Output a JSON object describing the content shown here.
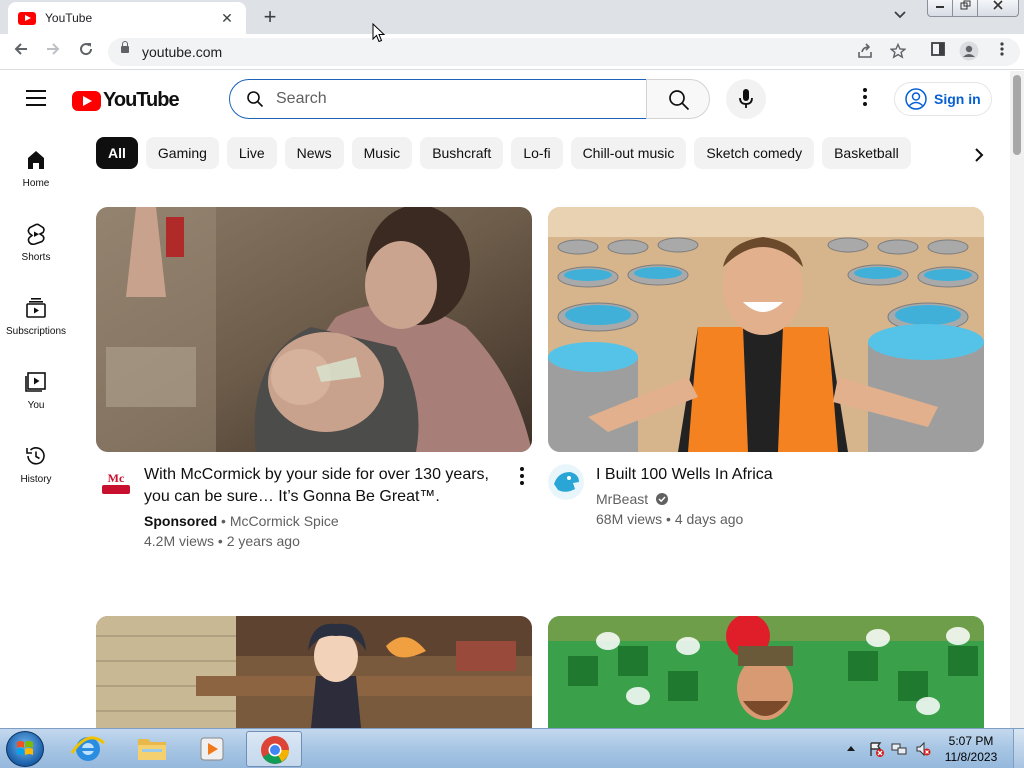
{
  "browser": {
    "tab_title": "YouTube",
    "tab_close": "✕",
    "new_tab": "+",
    "url": "youtube.com"
  },
  "youtube": {
    "logo_text": "YouTube",
    "search_placeholder": "Search",
    "sign_in": "Sign in",
    "chips": [
      "All",
      "Gaming",
      "Live",
      "News",
      "Music",
      "Bushcraft",
      "Lo-fi",
      "Chill-out music",
      "Sketch comedy",
      "Basketball"
    ],
    "guide": [
      {
        "label": "Home",
        "icon": "home-icon"
      },
      {
        "label": "Shorts",
        "icon": "shorts-icon"
      },
      {
        "label": "Subscriptions",
        "icon": "subscriptions-icon"
      },
      {
        "label": "You",
        "icon": "you-icon"
      },
      {
        "label": "History",
        "icon": "history-icon"
      }
    ],
    "videos": [
      {
        "title_line1": "With McCormick by your side for over 130 years,",
        "title_line2": "you can be sure… It’s Gonna Be Great™.",
        "badge": "Sponsored",
        "channel": "McCormick Spice",
        "views": "4.2M views",
        "age": "2 years ago",
        "avatar_text": "McCormick"
      },
      {
        "title_line1": "I Built 100 Wells In Africa",
        "channel": "MrBeast",
        "verified": true,
        "views": "68M views",
        "age": "4 days ago"
      }
    ],
    "meta_separator": "•"
  },
  "taskbar": {
    "time": "5:07 PM",
    "date": "11/8/2023"
  },
  "colors": {
    "youtube_red": "#ff0000",
    "link_blue": "#065fd4",
    "chip_active": "#0f0f0f",
    "chip_bg": "#f2f2f2"
  }
}
